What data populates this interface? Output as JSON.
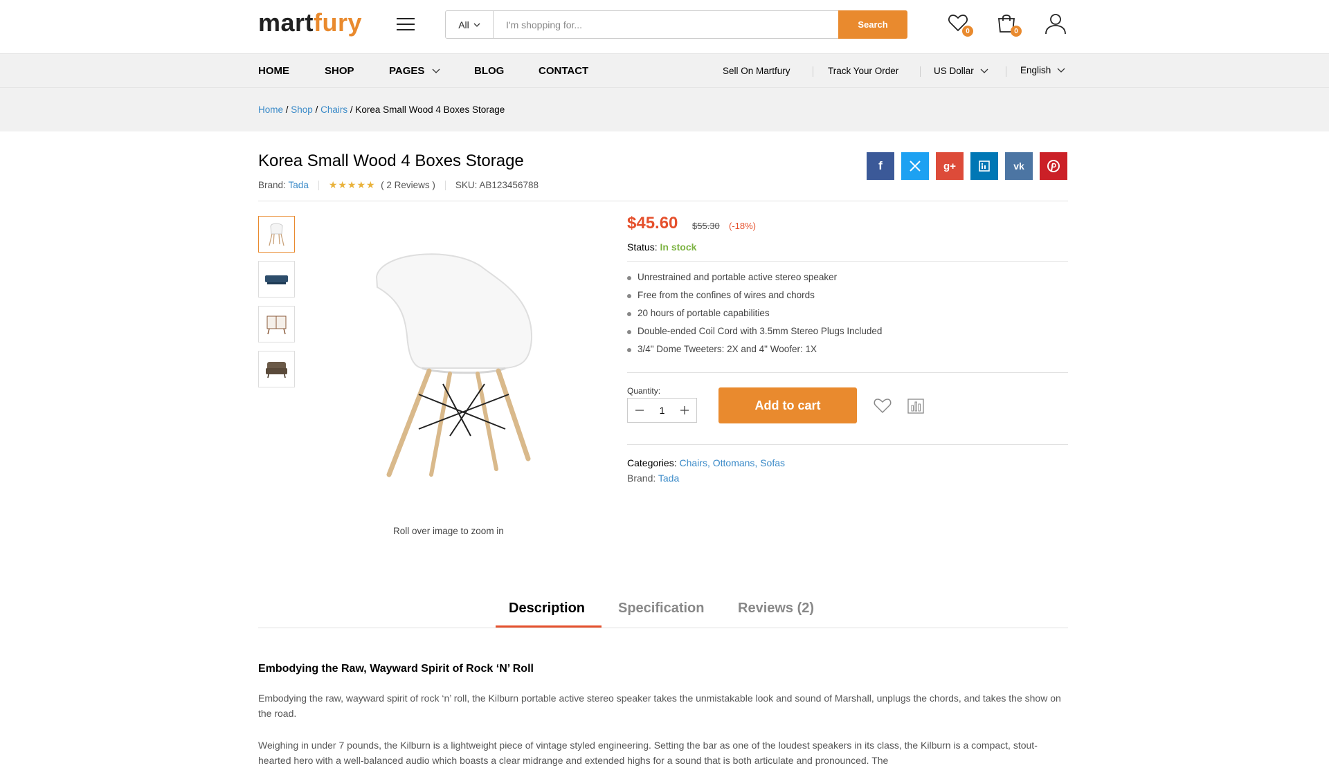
{
  "header": {
    "logo_part1": "mart",
    "logo_part2": "fury",
    "search_category": "All",
    "search_placeholder": "I'm shopping for...",
    "search_button": "Search",
    "wishlist_count": "0",
    "cart_count": "0",
    "brand_color": "#e98a2e"
  },
  "nav": {
    "items": [
      "HOME",
      "SHOP",
      "PAGES",
      "BLOG",
      "CONTACT"
    ],
    "right": [
      "Sell On Martfury",
      "Track Your Order",
      "US Dollar",
      "English"
    ]
  },
  "breadcrumb": [
    "Home",
    "Shop",
    "Chairs",
    "Korea Small Wood 4 Boxes Storage"
  ],
  "product": {
    "title": "Korea Small Wood 4 Boxes Storage",
    "brand_label": "Brand:",
    "brand": "Tada",
    "rating_stars": "★★★★★",
    "reviews": "( 2 Reviews )",
    "sku": "SKU: AB123456788",
    "price": "$45.60",
    "old_price": "$55.30",
    "discount": "(-18%)",
    "status_label": "Status:",
    "status_value": "In stock",
    "features": [
      "Unrestrained and portable active stereo speaker",
      "Free from the confines of wires and chords",
      "20 hours of portable capabilities",
      "Double-ended Coil Cord with 3.5mm Stereo Plugs Included",
      "3/4\" Dome Tweeters: 2X and 4\" Woofer: 1X"
    ],
    "quantity_label": "Quantity:",
    "quantity": "1",
    "add_to_cart": "Add to cart",
    "categories_label": "Categories:",
    "categories": [
      "Chairs,",
      "Ottomans,",
      "Sofas"
    ],
    "brand2_label": "Brand:",
    "brand2": "Tada",
    "zoom_hint": "Roll over image to zoom in"
  },
  "share_icons": [
    "facebook-icon",
    "twitter-icon",
    "google-plus-icon",
    "linkedin-icon",
    "vk-icon",
    "pinterest-icon"
  ],
  "tabs": [
    "Description",
    "Specification",
    "Reviews (2)"
  ],
  "description": {
    "heading": "Embodying the Raw, Wayward Spirit of Rock ‘N’ Roll",
    "p1": "Embodying the raw, wayward spirit of rock ‘n’ roll, the Kilburn portable active stereo speaker takes the unmistakable look and sound of Marshall, unplugs the chords, and takes the show on the road.",
    "p2": "Weighing in under 7 pounds, the Kilburn is a lightweight piece of vintage styled engineering. Setting the bar as one of the loudest speakers in its class, the Kilburn is a compact, stout-hearted hero with a well-balanced audio which boasts a clear midrange and extended highs for a sound that is both articulate and pronounced. The"
  }
}
